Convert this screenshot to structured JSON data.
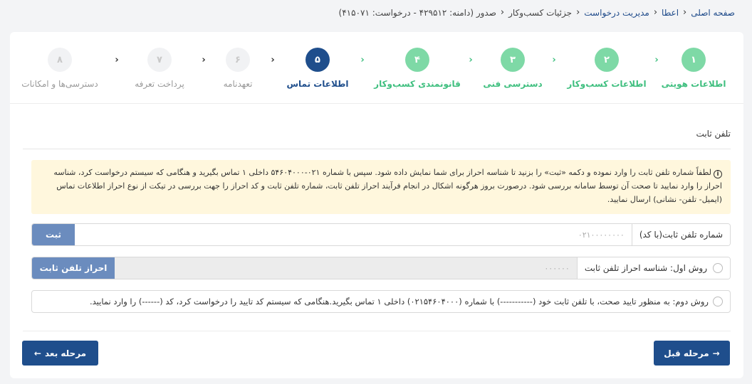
{
  "breadcrumb": {
    "items": [
      "صفحه اصلی",
      "اعطا",
      "مدیریت درخواست",
      "جزئیات کسب‌وکار"
    ],
    "current": "صدور (دامنه: ۴۲۹۵۱۲ - درخواست: ۴۱۵۰۷۱)"
  },
  "steps": [
    {
      "number": "۱",
      "label": "اطلاعات هویتی",
      "state": "done"
    },
    {
      "number": "۲",
      "label": "اطلاعات کسب‌وکار",
      "state": "done"
    },
    {
      "number": "۳",
      "label": "دسترسی فنی",
      "state": "done"
    },
    {
      "number": "۴",
      "label": "قانونمندی کسب‌وکار",
      "state": "done"
    },
    {
      "number": "۵",
      "label": "اطلاعات تماس",
      "state": "active"
    },
    {
      "number": "۶",
      "label": "تعهدنامه",
      "state": "pending"
    },
    {
      "number": "۷",
      "label": "پرداخت تعرفه",
      "state": "pending"
    },
    {
      "number": "۸",
      "label": "دسترسی‌ها و امکانات",
      "state": "pending"
    }
  ],
  "section": {
    "title": "تلفن ثابت"
  },
  "notice": {
    "text": "لطفاً شماره تلفن ثابت را وارد نموده و دکمه «ثبت» را بزنید تا شناسه احراز برای شما نمایش داده شود. سپس با شماره ۰۲۱-۵۴۶۰۴۰۰۰ داخلی ۱ تماس بگیرید و هنگامی که سیستم درخواست کرد، شناسه احراز را وارد نمایید تا صحت آن توسط سامانه بررسی شود. درصورت بروز هرگونه اشکال در انجام فرآیند احراز تلفن ثابت، شماره تلفن ثابت و کد احراز را جهت بررسی در تیکت از نوع احراز اطلاعات تماس (ایمیل- تلفن- نشانی) ارسال نمایید."
  },
  "phone_row": {
    "label": "شماره تلفن ثابت(با کد)",
    "placeholder": "۰۲۱۰۰۰۰۰۰۰۰",
    "submit": "ثبت"
  },
  "method1": {
    "label": "روش اول: شناسه احراز تلفن ثابت",
    "value": "۰۰۰۰۰۰",
    "button": "احراز تلفن ثابت"
  },
  "method2": {
    "text": "روش دوم: به منظور تایید صحت، با تلفن ثابت خود (-----------) با شماره (۰۲۱۵۴۶۰۴۰۰۰) داخلی ۱ تماس بگیرید.هنگامی که سیستم کد تایید را درخواست کرد، کد (------) را وارد نمایید."
  },
  "nav": {
    "prev": "مرحله قبل",
    "next": "مرحله بعد"
  },
  "colors": {
    "done": "#7ed9a6",
    "active": "#1f4e8c",
    "pending": "#f1f2f4",
    "notice_bg": "#fff7dd"
  }
}
